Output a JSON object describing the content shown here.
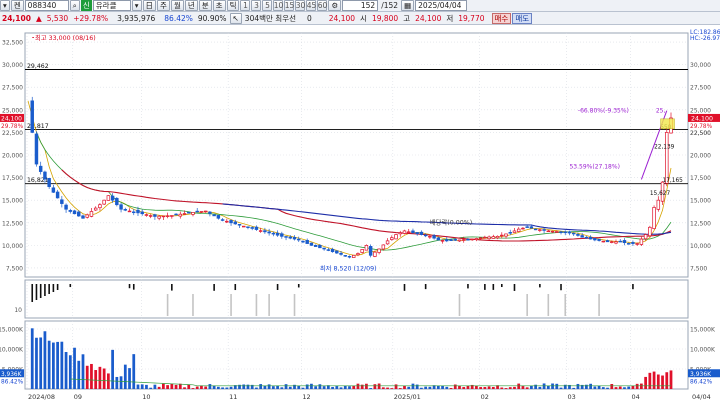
{
  "toolbar": {
    "code_label": "켄",
    "code_value": "088340",
    "badge": "신",
    "name": "유라클",
    "period_buttons": [
      "주",
      "월",
      "년",
      "분",
      "초",
      "틱"
    ],
    "interval_buttons": [
      "1",
      "3",
      "5",
      "10",
      "15",
      "30",
      "45",
      "60"
    ],
    "count_value": "152",
    "count_total": "/152",
    "date_value": "2025/04/04",
    "price": "24,100",
    "change_arrow": "▲",
    "change": "5,530",
    "change_rate": "+29.78%",
    "volume": "3,935,976",
    "ratio1": "86.42%",
    "ratio2": "90.90%",
    "ticker_info": "304백만 최우선",
    "ticker_zero": "0",
    "sise_price": "24,100",
    "sise_label": "시",
    "high_price": "19,800",
    "high_label": "고",
    "current": "24,100",
    "low_label": "저",
    "low_price": "19,770",
    "buy_label": "매수",
    "sell_label": "매도"
  },
  "chart_data": {
    "type": "candlestick",
    "price_axis": {
      "range": [
        6500,
        33500
      ],
      "ticks": [
        "32,500",
        "30,000",
        "27,500",
        "25,000",
        "22,500",
        "20,000",
        "17,500",
        "15,000",
        "12,500",
        "10,000",
        "7,500"
      ],
      "right_ticks": [
        "30,000",
        "27,500",
        "25,000",
        "22,500",
        "20,000",
        "17,500",
        "15,000",
        "12,500",
        "10,000",
        "7,500"
      ],
      "right_top": [
        "LC:182.86",
        "HC:-26.97"
      ],
      "current_label": "24,100",
      "current_left_label": "24,100",
      "current_rate": "29.78%",
      "current_rate_right": "29.78%",
      "right_extra_labels": [
        "22,500"
      ]
    },
    "horizontal_lines": [
      {
        "value": 29462,
        "label": "29,462"
      },
      {
        "value": 22817,
        "label": "22,817"
      },
      {
        "value": 16821,
        "label": "16,821"
      }
    ],
    "annotations": [
      {
        "text": "최고 33,000 (08/16)",
        "color": "#d6001c"
      },
      {
        "text": "최저 8,520 (12/09)",
        "color": "#1746d1"
      },
      {
        "text": "배당락(0.00%)",
        "color": "#333333"
      },
      {
        "text": "-66.80%(-9.35%)",
        "color": "#9b1fd1"
      },
      {
        "text": "25,",
        "color": "#9b1fd1"
      },
      {
        "text": "53.59%(27.18%)",
        "color": "#9b1fd1"
      },
      {
        "text": "550",
        "color": "#111111"
      },
      {
        "text": "22,139",
        "color": "#111111"
      },
      {
        "text": "17,165",
        "color": "#111111"
      },
      {
        "text": "15,627",
        "color": "#111111"
      }
    ],
    "x_labels": [
      "2024/08",
      "09",
      "10",
      "11",
      "12",
      "2025/01",
      "02",
      "03",
      "04",
      "04/04"
    ],
    "osc_axis": {
      "ticks": [
        "10"
      ]
    },
    "volume_axis": {
      "ticks": [
        "15,000K",
        "10,000K",
        "5,000K"
      ],
      "right_ticks": [
        "15,000K",
        "10,000K",
        "5,000K"
      ],
      "current_label": "3,936K",
      "current_rate": "86.42%",
      "current_rate_right": "86.42%"
    },
    "close_path": [
      [
        0,
        26000
      ],
      [
        2,
        19000
      ],
      [
        5,
        16500
      ],
      [
        9,
        14000
      ],
      [
        13,
        13000
      ],
      [
        17,
        14500
      ],
      [
        19,
        15500
      ],
      [
        22,
        14000
      ],
      [
        26,
        13600
      ],
      [
        30,
        13200
      ],
      [
        34,
        13300
      ],
      [
        38,
        13600
      ],
      [
        42,
        13800
      ],
      [
        45,
        13000
      ],
      [
        48,
        12500
      ],
      [
        52,
        12000
      ],
      [
        56,
        11500
      ],
      [
        60,
        11000
      ],
      [
        64,
        10600
      ],
      [
        67,
        10000
      ],
      [
        70,
        9600
      ],
      [
        72,
        9300
      ],
      [
        74,
        9000
      ],
      [
        76,
        8700
      ],
      [
        78,
        9100
      ],
      [
        80,
        10000
      ],
      [
        81,
        8900
      ],
      [
        83,
        9600
      ],
      [
        85,
        10500
      ],
      [
        87,
        11200
      ],
      [
        89,
        11600
      ],
      [
        91,
        11400
      ],
      [
        93,
        11200
      ],
      [
        95,
        11000
      ],
      [
        97,
        10600
      ],
      [
        99,
        10500
      ],
      [
        102,
        10600
      ],
      [
        105,
        10700
      ],
      [
        108,
        10900
      ],
      [
        111,
        11000
      ],
      [
        114,
        11400
      ],
      [
        116,
        11800
      ],
      [
        118,
        12000
      ],
      [
        120,
        11800
      ],
      [
        123,
        11600
      ],
      [
        126,
        11500
      ],
      [
        129,
        11300
      ],
      [
        131,
        10900
      ],
      [
        134,
        10600
      ],
      [
        137,
        10400
      ],
      [
        140,
        10400
      ],
      [
        142,
        10200
      ],
      [
        144,
        10200
      ],
      [
        146,
        11200
      ],
      [
        147,
        12000
      ],
      [
        148,
        14200
      ],
      [
        149,
        15000
      ],
      [
        150,
        17000
      ],
      [
        151,
        22500
      ],
      [
        152,
        24100
      ]
    ]
  }
}
